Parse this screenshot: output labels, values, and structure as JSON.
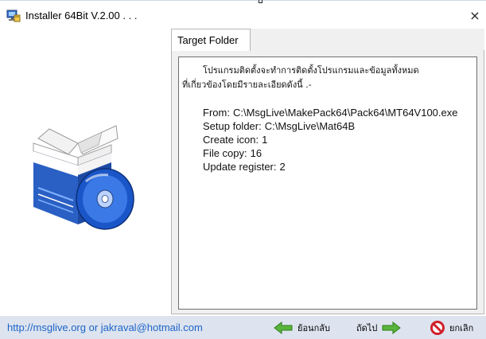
{
  "window": {
    "title": "Installer 64Bit V.2.00 . . .",
    "close_glyph": "×"
  },
  "tab": {
    "label": "Target Folder"
  },
  "content": {
    "thai_line1": "โปรแกรมติดตั้งจะทำการติดตั้งโปรแกรมและข้อมูลทั้งหมด",
    "thai_line2": "ที่เกี่ยวข้องโดยมีรายละเอียดดังนี้ .-",
    "from_label": "From:",
    "from_value": "C:\\MsgLive\\MakePack64\\Pack64\\MT64V100.exe",
    "setup_label": "Setup folder:",
    "setup_value": "C:\\MsgLive\\Mat64B",
    "icon_label": "Create icon:",
    "icon_value": "1",
    "copy_label": "File copy:",
    "copy_value": "16",
    "register_label": "Update register:",
    "register_value": "2"
  },
  "footer": {
    "link_text": "http://msglive.org or jakraval@hotmail.com",
    "back_label": "ย้อนกลับ",
    "next_label": "ถัดไป",
    "cancel_label": "ยกเลิก"
  },
  "icons": {
    "app": "installer-icon",
    "close": "close-icon",
    "back": "arrow-left-icon",
    "next": "arrow-right-icon",
    "cancel": "prohibited-icon",
    "product": "software-box-icon"
  },
  "colors": {
    "footer_bg": "#dde4ef",
    "link": "#1e64c8",
    "arrow_green": "#59b43c",
    "cancel_red": "#d0202a",
    "box_blue": "#2a5fc4"
  }
}
